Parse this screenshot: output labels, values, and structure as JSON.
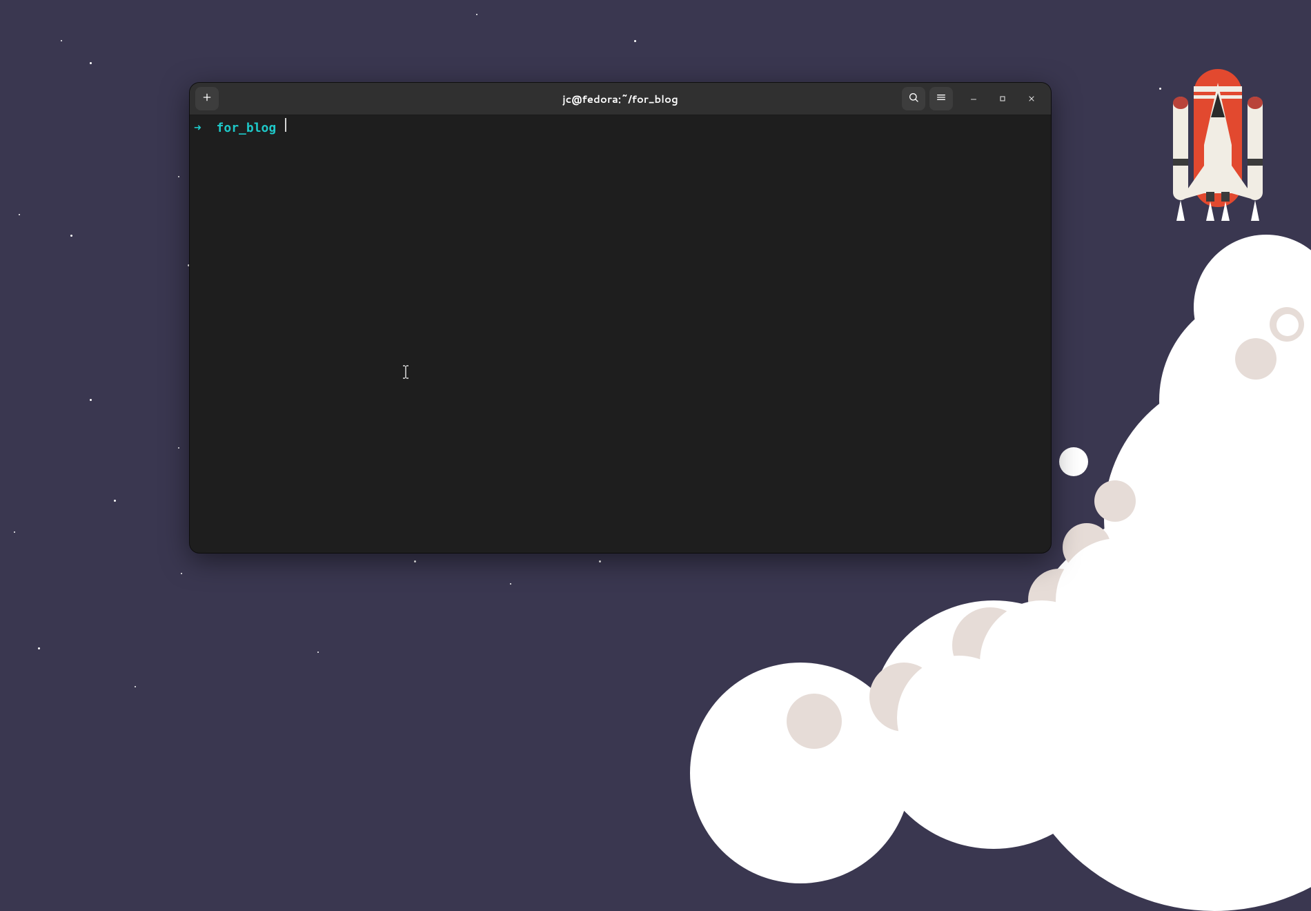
{
  "window": {
    "title": "jc@fedora:~/for_blog"
  },
  "prompt": {
    "arrow": "➜",
    "dir": "for_blog",
    "command": ""
  },
  "icons": {
    "new_tab": "plus-icon",
    "search": "search-icon",
    "menu": "hamburger-icon",
    "minimize": "minimize-icon",
    "maximize": "maximize-icon",
    "close": "close-icon"
  },
  "colors": {
    "accent": "#1ec8c8",
    "terminal_bg": "#1e1e1e",
    "titlebar_bg": "#303030",
    "wallpaper_bg": "#3a3750",
    "shuttle_orange": "#e2492f",
    "shuttle_light": "#f1ede4"
  }
}
